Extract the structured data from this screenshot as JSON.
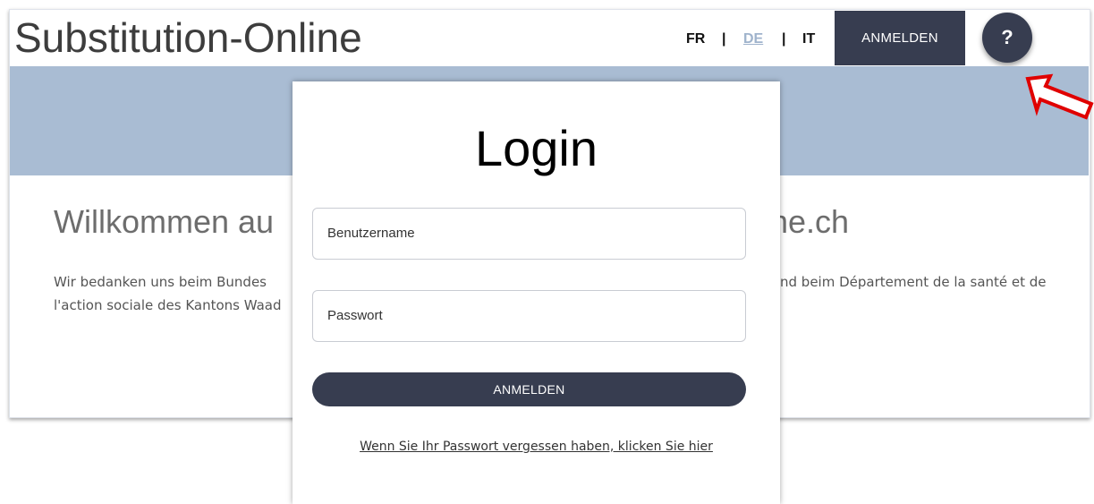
{
  "header": {
    "site_title": "Substitution-Online",
    "languages": [
      {
        "code": "FR",
        "active": false
      },
      {
        "code": "DE",
        "active": true
      },
      {
        "code": "IT",
        "active": false
      }
    ],
    "separator": "|",
    "login_button": "ANMELDEN",
    "help_button": "?"
  },
  "main": {
    "welcome_left": "Willkommen au",
    "welcome_right": "ne.ch",
    "paragraph_line1_left": "Wir bedanken uns beim Bundes",
    "paragraph_line1_right": "nd beim Département de la santé et de",
    "paragraph_line2_left": "l'action sociale des Kantons Waad"
  },
  "login_modal": {
    "title": "Login",
    "username_placeholder": "Benutzername",
    "password_placeholder": "Passwort",
    "submit_label": "ANMELDEN",
    "forgot_link": "Wenn Sie Ihr Passwort vergessen haben, klicken Sie hier"
  },
  "colors": {
    "accent": "#373d50",
    "banner": "#a9bcd3",
    "active_language": "#9fb3cc",
    "annotation_arrow": "#e00000"
  }
}
